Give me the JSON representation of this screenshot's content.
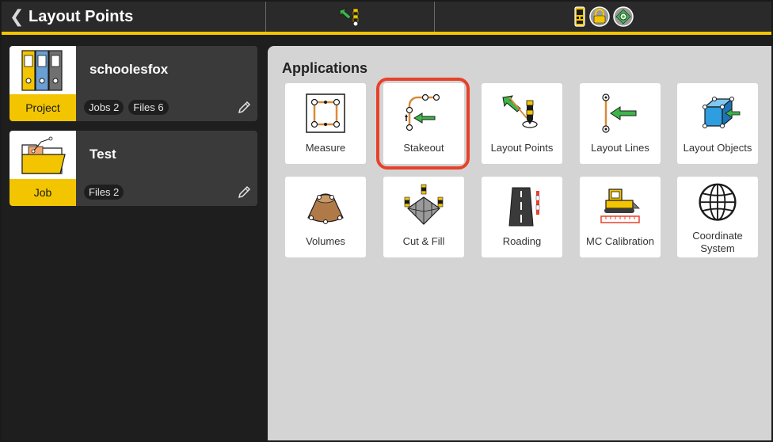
{
  "header": {
    "title": "Layout Points",
    "back_icon": "chevron-left-icon",
    "center_icon": "layout-points-mode-icon",
    "status_icons": [
      "controller-icon",
      "lock-icon",
      "gnss-receiver-icon"
    ]
  },
  "cards": [
    {
      "name": "schoolesfox",
      "type": "Project",
      "chips": [
        "Jobs 2",
        "Files 6"
      ],
      "icon": "binders-icon"
    },
    {
      "name": "Test",
      "type": "Job",
      "chips": [
        "Files 2"
      ],
      "icon": "open-folder-icon"
    }
  ],
  "applications": {
    "heading": "Applications",
    "tiles": [
      {
        "label": "Measure",
        "icon": "measure-icon"
      },
      {
        "label": "Stakeout",
        "icon": "stakeout-icon",
        "selected": true
      },
      {
        "label": "Layout Points",
        "icon": "layout-points-icon"
      },
      {
        "label": "Layout Lines",
        "icon": "layout-lines-icon"
      },
      {
        "label": "Layout Objects",
        "icon": "layout-objects-icon"
      },
      {
        "label": "Volumes",
        "icon": "volumes-icon"
      },
      {
        "label": "Cut & Fill",
        "icon": "cut-fill-icon"
      },
      {
        "label": "Roading",
        "icon": "roading-icon"
      },
      {
        "label": "MC Calibration",
        "icon": "mc-calibration-icon"
      },
      {
        "label": "Coordinate System",
        "icon": "coordinate-system-icon"
      }
    ]
  },
  "colors": {
    "accent": "#f2c500",
    "highlight": "#e8412a",
    "panel": "#d4d4d4",
    "dark": "#1e1e1e"
  }
}
